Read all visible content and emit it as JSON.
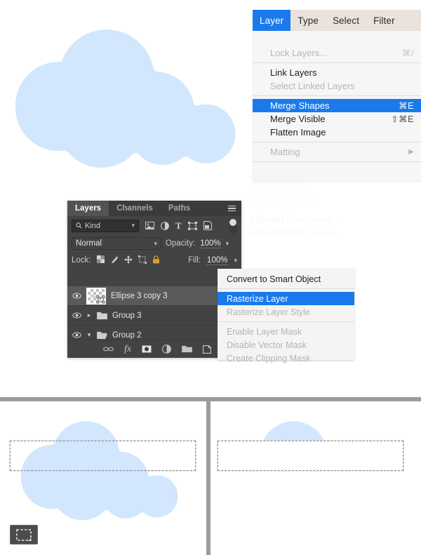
{
  "menubar": {
    "items": [
      {
        "label": "Layer",
        "active": true
      },
      {
        "label": "Type",
        "active": false
      },
      {
        "label": "Select",
        "active": false
      },
      {
        "label": "Filter",
        "active": false
      }
    ]
  },
  "layer_menu": {
    "items": [
      {
        "label": "Lock Layers...",
        "shortcut": "⌘/",
        "state": "dim"
      },
      {
        "label": "Link Layers",
        "shortcut": "",
        "state": "normal"
      },
      {
        "label": "Select Linked Layers",
        "shortcut": "",
        "state": "dim"
      },
      {
        "label": "Merge Shapes",
        "shortcut": "⌘E",
        "state": "selected"
      },
      {
        "label": "Merge Visible",
        "shortcut": "⇧⌘E",
        "state": "normal"
      },
      {
        "label": "Flatten Image",
        "shortcut": "",
        "state": "normal"
      },
      {
        "label": "Matting",
        "shortcut": "",
        "state": "dim",
        "submenu": true
      }
    ]
  },
  "background_menu": {
    "items": [
      "Group Layers",
      "Ungroup Layers",
      "Artboard from Group...",
      "Artboard from Layers...",
      "Link Layers",
      "Select Linked Layers"
    ]
  },
  "layers_panel": {
    "tabs": [
      {
        "label": "Layers",
        "active": true
      },
      {
        "label": "Channels",
        "active": false
      },
      {
        "label": "Paths",
        "active": false
      }
    ],
    "menu_icon": "hamburger-icon",
    "filter": {
      "label": "Kind",
      "icon": "search-icon"
    },
    "filter_type_icons": [
      "pixel-layer-icon",
      "adjustment-layer-icon",
      "type-layer-icon",
      "shape-layer-icon",
      "smart-object-icon"
    ],
    "filter_toggle": "filter-enable-toggle",
    "blend_mode": "Normal",
    "opacity_label": "Opacity:",
    "opacity_value": "100%",
    "lock_label": "Lock:",
    "lock_icons": [
      "lock-transparent-pixels-icon",
      "lock-image-pixels-icon",
      "lock-position-icon",
      "lock-artboard-icon",
      "lock-all-icon"
    ],
    "fill_label": "Fill:",
    "fill_value": "100%",
    "layers": [
      {
        "name": "Ellipse 3 copy 3",
        "type": "layer",
        "visible": true,
        "selected": true,
        "thumb": "checkerboard-cloud-thumbnail",
        "badge": "vector-mask-badge"
      },
      {
        "name": "Group 3",
        "type": "group",
        "visible": true,
        "selected": false,
        "expanded": false
      },
      {
        "name": "Group 2",
        "type": "group",
        "visible": true,
        "selected": false,
        "expanded": true
      }
    ],
    "footer_icons": [
      "link-layers-icon",
      "layer-style-fx-icon",
      "layer-mask-icon",
      "adjustment-layer-icon",
      "new-group-icon",
      "new-layer-icon",
      "delete-layer-icon"
    ]
  },
  "context_menu": {
    "items": [
      {
        "label": "Convert to Smart Object",
        "state": "normal"
      },
      {
        "label": "Rasterize Layer",
        "state": "selected"
      },
      {
        "label": "Rasterize Layer Style",
        "state": "dim"
      },
      {
        "label": "Enable Layer Mask",
        "state": "dim"
      },
      {
        "label": "Disable Vector Mask",
        "state": "dim"
      },
      {
        "label": "Create Clipping Mask",
        "state": "dim"
      }
    ]
  },
  "canvas": {
    "top_cloud": {
      "fill": "#d2e7fd",
      "name": "cloud-shape"
    },
    "panel_left": {
      "name": "canvas-cloud-with-selection",
      "cloud_fill": "#d2e7fd",
      "selection": "rectangular-marquee-selection"
    },
    "panel_right": {
      "name": "canvas-cloud-bottom-deleted",
      "cloud_fill": "#d2e7fd",
      "selection": "rectangular-marquee-selection"
    },
    "tool_badge": "rectangular-marquee-tool-icon"
  },
  "colors": {
    "accent": "#1a7aeb",
    "cloud": "#d2e7fd",
    "panel_bg": "#434343",
    "menu_bg": "#f6f6f6",
    "menubar_bg": "#eae3dd",
    "divider": "#9b9b9b"
  }
}
